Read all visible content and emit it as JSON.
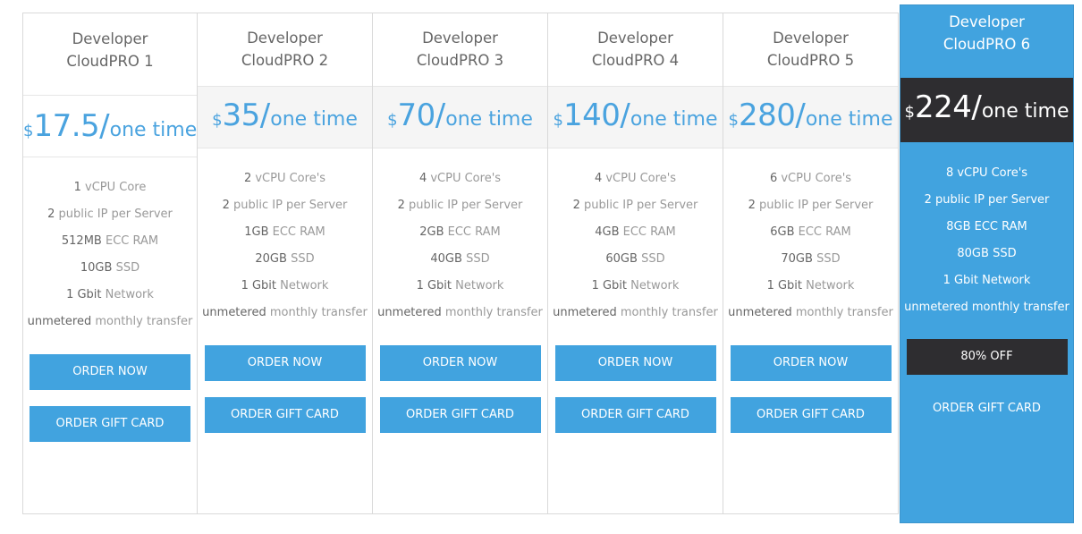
{
  "plans": [
    {
      "title_line1": "Developer",
      "title_line2": "CloudPRO 1",
      "price_currency": "$",
      "price_amount": "17.5",
      "price_slash": "/",
      "price_period": "one time",
      "features": [
        {
          "hl": "1",
          "rest": " vCPU Core"
        },
        {
          "hl": "2",
          "rest": " public IP per Server"
        },
        {
          "hl": "512MB",
          "rest": " ECC RAM"
        },
        {
          "hl": "10GB",
          "rest": " SSD"
        },
        {
          "hl": "1 Gbit",
          "rest": " Network"
        },
        {
          "hl": "unmetered",
          "rest": " monthly transfer"
        }
      ],
      "button1": "ORDER NOW",
      "button2": "ORDER GIFT CARD"
    },
    {
      "title_line1": "Developer",
      "title_line2": "CloudPRO 2",
      "price_currency": "$",
      "price_amount": "35",
      "price_slash": "/",
      "price_period": "one time",
      "features": [
        {
          "hl": "2",
          "rest": " vCPU Core's"
        },
        {
          "hl": "2",
          "rest": " public IP per Server"
        },
        {
          "hl": "1GB",
          "rest": " ECC RAM"
        },
        {
          "hl": "20GB",
          "rest": " SSD"
        },
        {
          "hl": "1 Gbit",
          "rest": " Network"
        },
        {
          "hl": "unmetered",
          "rest": " monthly transfer"
        }
      ],
      "button1": "ORDER NOW",
      "button2": "ORDER GIFT CARD"
    },
    {
      "title_line1": "Developer",
      "title_line2": "CloudPRO 3",
      "price_currency": "$",
      "price_amount": "70",
      "price_slash": "/",
      "price_period": "one time",
      "features": [
        {
          "hl": "4",
          "rest": " vCPU Core's"
        },
        {
          "hl": "2",
          "rest": " public IP per Server"
        },
        {
          "hl": "2GB",
          "rest": " ECC RAM"
        },
        {
          "hl": "40GB",
          "rest": " SSD"
        },
        {
          "hl": "1 Gbit",
          "rest": " Network"
        },
        {
          "hl": "unmetered",
          "rest": " monthly transfer"
        }
      ],
      "button1": "ORDER NOW",
      "button2": "ORDER GIFT CARD"
    },
    {
      "title_line1": "Developer",
      "title_line2": "CloudPRO 4",
      "price_currency": "$",
      "price_amount": "140",
      "price_slash": "/",
      "price_period": "one time",
      "features": [
        {
          "hl": "4",
          "rest": " vCPU Core's"
        },
        {
          "hl": "2",
          "rest": " public IP per Server"
        },
        {
          "hl": "4GB",
          "rest": " ECC RAM"
        },
        {
          "hl": "60GB",
          "rest": " SSD"
        },
        {
          "hl": "1 Gbit",
          "rest": " Network"
        },
        {
          "hl": "unmetered",
          "rest": " monthly transfer"
        }
      ],
      "button1": "ORDER NOW",
      "button2": "ORDER GIFT CARD"
    },
    {
      "title_line1": "Developer",
      "title_line2": "CloudPRO 5",
      "price_currency": "$",
      "price_amount": "280",
      "price_slash": "/",
      "price_period": "one time",
      "features": [
        {
          "hl": "6",
          "rest": " vCPU Core's"
        },
        {
          "hl": "2",
          "rest": " public IP per Server"
        },
        {
          "hl": "6GB",
          "rest": " ECC RAM"
        },
        {
          "hl": "70GB",
          "rest": " SSD"
        },
        {
          "hl": "1 Gbit",
          "rest": " Network"
        },
        {
          "hl": "unmetered",
          "rest": " monthly transfer"
        }
      ],
      "button1": "ORDER NOW",
      "button2": "ORDER GIFT CARD"
    },
    {
      "title_line1": "Developer",
      "title_line2": "CloudPRO 6",
      "price_currency": "$",
      "price_amount": "224",
      "price_slash": "/",
      "price_period": "one time",
      "features": [
        {
          "hl": "8",
          "rest": " vCPU Core's"
        },
        {
          "hl": "2",
          "rest": " public IP per Server"
        },
        {
          "hl": "8GB",
          "rest": " ECC RAM"
        },
        {
          "hl": "80GB",
          "rest": " SSD"
        },
        {
          "hl": "1 Gbit",
          "rest": " Network"
        },
        {
          "hl": "unmetered",
          "rest": " monthly transfer"
        }
      ],
      "button1": "80% OFF",
      "button2": "ORDER GIFT CARD"
    }
  ],
  "colors": {
    "accent": "#41a3df",
    "price_text": "#4aa3df",
    "dark": "#2e2d30",
    "muted_text": "#999999",
    "highlight_text": "#666666"
  }
}
